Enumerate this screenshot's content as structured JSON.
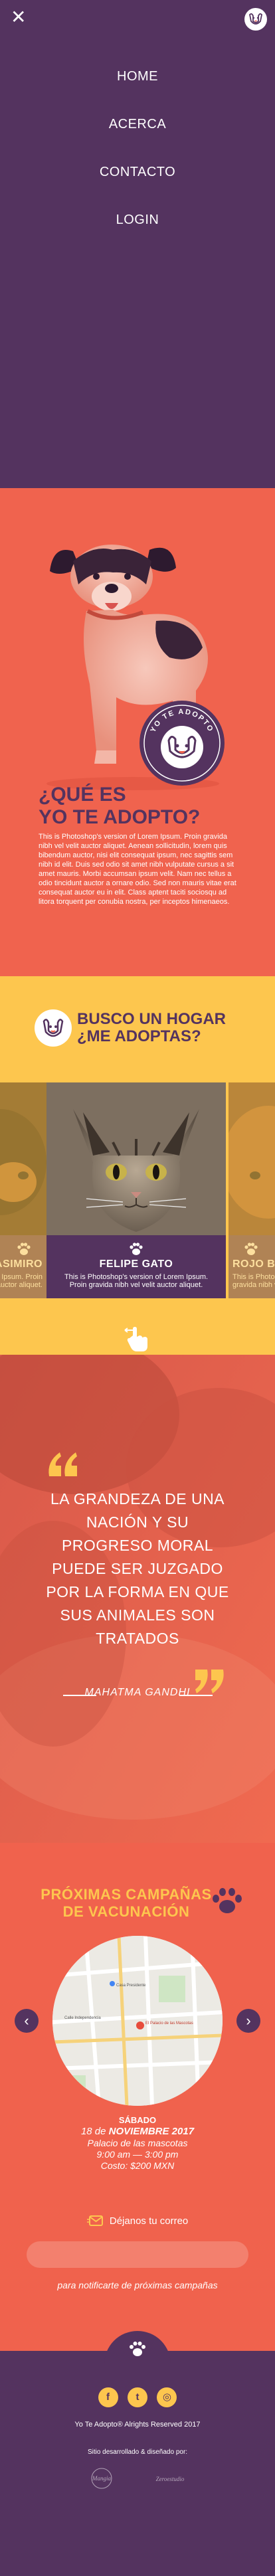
{
  "colors": {
    "purple": "#54335f",
    "coral": "#f0634e",
    "yellow": "#fdc64e",
    "white": "#ffffff"
  },
  "nav": {
    "close_icon": "close-icon",
    "badge_icon": "dog-logo-icon",
    "items": [
      {
        "label": "HOME"
      },
      {
        "label": "ACERCA"
      },
      {
        "label": "CONTACTO"
      },
      {
        "label": "LOGIN"
      }
    ]
  },
  "about": {
    "seal_text": "YO TE ADOPTO",
    "title_line1": "¿QUÉ ES",
    "title_line2": "YO TE ADOPTO?",
    "text": "This is Photoshop's version of Lorem Ipsum. Proin gravida nibh vel velit auctor aliquet. Aenean sollicitudin, lorem quis bibendum auctor, nisi elit consequat ipsum, nec sagittis sem nibh id elit. Duis sed odio sit amet nibh vulputate cursus a sit amet mauris. Morbi accumsan ipsum velit. Nam nec tellus a odio tincidunt auctor a ornare odio. Sed non mauris vitae erat consequat auctor eu in elit. Class aptent taciti sociosqu ad litora torquent per conubia nostra, per inceptos himenaeos."
  },
  "adopt": {
    "title_line1": "BUSCO UN HOGAR",
    "title_line2": "¿ME ADOPTAS?",
    "cards": [
      {
        "name": "CASIMIRO",
        "desc": "This is Photoshop's version of Lorem Ipsum. Proin gravida nibh vel velit auctor aliquet."
      },
      {
        "name": "FELIPE GATO",
        "desc": "This is Photoshop's version of Lorem Ipsum. Proin gravida nibh vel velit auctor aliquet."
      },
      {
        "name": "ROJO BENITO",
        "desc": "This is Photoshop's version of Lorem Ipsum. Proin gravida nibh vel velit auctor aliquet."
      }
    ],
    "swipe_icon": "swipe-hand-icon"
  },
  "quote": {
    "text": "LA GRANDEZA DE UNA NACIÓN Y SU PROGRESO MORAL PUEDE SER JUZGADO POR LA FORMA EN QUE SUS ANIMALES SON TRATADOS",
    "author": "MAHATMA GANDHI"
  },
  "campaigns": {
    "title_line1": "PRÓXIMAS CAMPAÑAS",
    "title_line2": "DE VACUNACIÓN",
    "map": {
      "label_1": "El Palacio de las Mascotas",
      "label_2": "Calle Independencia",
      "label_3": "Casa Presidente"
    },
    "event": {
      "day": "SÁBADO",
      "date_prefix": "18 de ",
      "date_month": "NOVIEMBRE 2017",
      "place": "Palacio de las mascotas",
      "time": "9:00 am — 3:00 pm",
      "cost": "Costo: $200 MXN"
    },
    "mail_label": "Déjanos tu correo",
    "mail_placeholder": "",
    "mail_note": "para notificarte de próximas campañas"
  },
  "footer": {
    "socials": [
      {
        "icon": "facebook-icon",
        "glyph": "f"
      },
      {
        "icon": "twitter-icon",
        "glyph": "t"
      },
      {
        "icon": "instagram-icon",
        "glyph": "◎"
      }
    ],
    "copyright": "Yo Te Adopto® Alrights Reserved 2017",
    "credit": "Sitio desarrollado & diseñado por:",
    "credit_logo_1": "Mangia",
    "credit_logo_2": "Zeroestudio"
  }
}
